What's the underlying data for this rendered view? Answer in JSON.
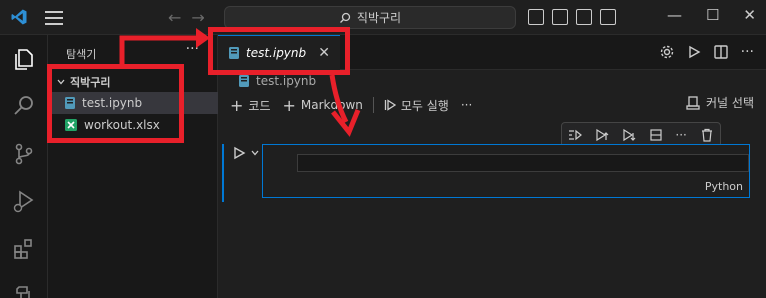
{
  "titlebar": {
    "search_text": "직박구리",
    "nav_back": "←",
    "nav_forward": "→",
    "window_minimize": "—",
    "window_maximize": "☐",
    "window_close": "✕"
  },
  "sidebar": {
    "title": "탐색기",
    "more": "···",
    "folder": "직박구리",
    "files": [
      {
        "name": "test.ipynb",
        "type": "notebook",
        "selected": true
      },
      {
        "name": "workout.xlsx",
        "type": "excel",
        "selected": false
      }
    ]
  },
  "tab": {
    "label": "test.ipynb",
    "close": "✕"
  },
  "breadcrumb": {
    "file": "test.ipynb"
  },
  "notebook_toolbar": {
    "add_code": "코드",
    "add_markdown": "Markdown",
    "run_all": "모두 실행",
    "more": "···",
    "kernel": "커널 선택"
  },
  "cell": {
    "language": "Python",
    "content": ""
  },
  "colors": {
    "accent": "#0078d4",
    "annotation_red": "#e8202a",
    "excel_green": "#21a366",
    "notebook_blue": "#519aba"
  }
}
